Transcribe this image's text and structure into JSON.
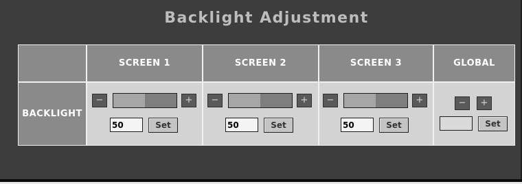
{
  "title": "Backlight Adjustment",
  "columns": [
    "SCREEN 1",
    "SCREEN 2",
    "SCREEN 3",
    "GLOBAL"
  ],
  "row_label": "BACKLIGHT",
  "screens": [
    {
      "value": "50",
      "level": 0.5,
      "minus": "−",
      "plus": "+",
      "set_label": "Set"
    },
    {
      "value": "50",
      "level": 0.5,
      "minus": "−",
      "plus": "+",
      "set_label": "Set"
    },
    {
      "value": "50",
      "level": 0.5,
      "minus": "−",
      "plus": "+",
      "set_label": "Set"
    }
  ],
  "global": {
    "value": "",
    "minus": "−",
    "plus": "+",
    "set_label": "Set"
  },
  "colors": {
    "panel": "#3d3d3d",
    "header": "#8a8a8a",
    "control_area": "#d3d3d3",
    "title": "#bdbdbd"
  }
}
